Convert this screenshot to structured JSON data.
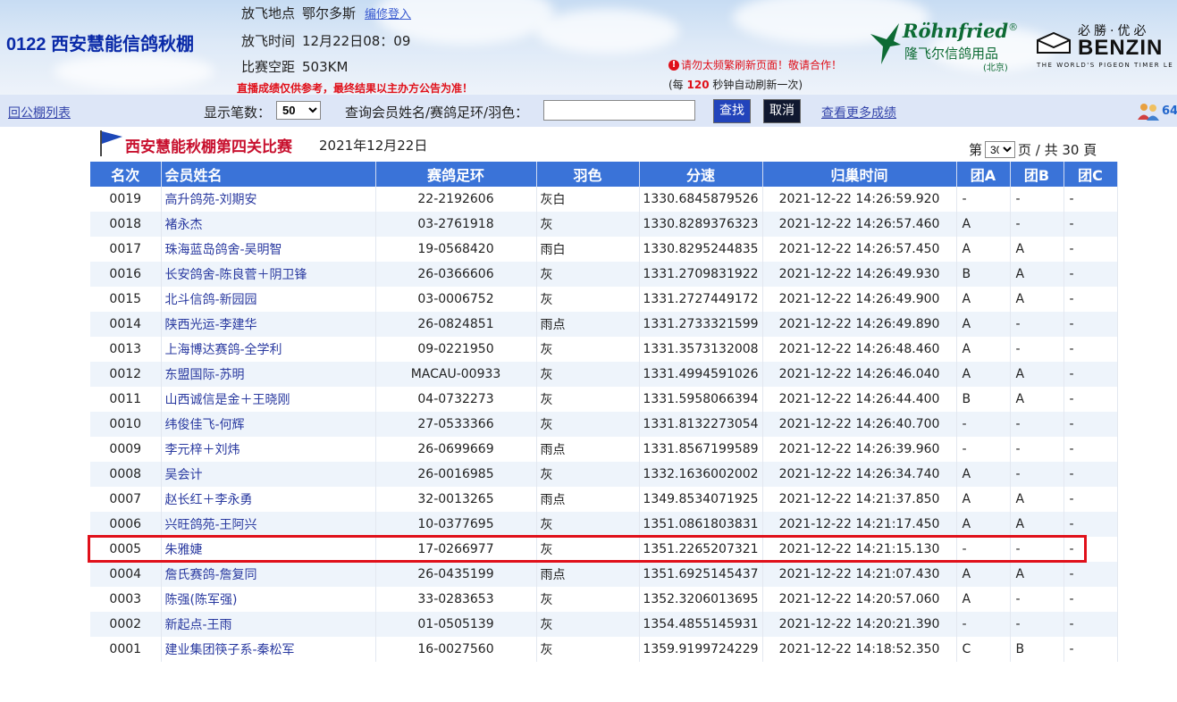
{
  "header": {
    "title": "0122 西安慧能信鸽秋棚",
    "release_location_label": "放飞地点",
    "release_location": "鄂尔多斯",
    "relogin_link": "编修登入",
    "release_time_label": "放飞时间",
    "release_time": "12月22日08：09",
    "distance_label": "比赛空距",
    "distance": "503KM",
    "disclaimer": "直播成绩仅供参考，最终结果以主办方公告为准！",
    "warning": "请勿太频繁刷新页面！敬请合作！",
    "refresh_prefix": "(每 ",
    "refresh_seconds": "120",
    "refresh_suffix": " 秒钟自动刷新一次)",
    "brand1_name": "Röhnfried",
    "brand1_mark": "®",
    "brand1_cn": "隆飞尔信鸽用品",
    "brand1_city": "(北京)",
    "brand2_top": "必勝·优必",
    "brand2_name": "BENZIN",
    "brand2_sub": "THE WORLD'S PIGEON TIMER LE"
  },
  "toolbar": {
    "back_link": "回公棚列表",
    "count_label": "显示笔数：",
    "count_value": "50",
    "query_label": "查询会员姓名/赛鸽足环/羽色：",
    "query_value": "",
    "search_button": "查找",
    "cancel_button": "取消",
    "more_link": "查看更多成绩",
    "online_count": "64"
  },
  "race": {
    "title": "西安慧能秋棚第四关比赛",
    "date": "2021年12月22日",
    "page_prefix": "第",
    "current_page": "30",
    "page_suffix": "页 / 共 30 頁"
  },
  "table": {
    "columns": [
      "名次",
      "会员姓名",
      "赛鸽足环",
      "羽色",
      "分速",
      "归巢时间",
      "团A",
      "团B",
      "团C"
    ],
    "rows": [
      [
        "0019",
        "高升鸽苑-刘期安",
        "22-2192606",
        "灰白",
        "1330.6845879526",
        "2021-12-22 14:26:59.920",
        "-",
        "-",
        "-"
      ],
      [
        "0018",
        "褚永杰",
        "03-2761918",
        "灰",
        "1330.8289376323",
        "2021-12-22 14:26:57.460",
        "A",
        "-",
        "-"
      ],
      [
        "0017",
        "珠海蓝岛鸽舍-吴明智",
        "19-0568420",
        "雨白",
        "1330.8295244835",
        "2021-12-22 14:26:57.450",
        "A",
        "A",
        "-"
      ],
      [
        "0016",
        "长安鸽舍-陈良菅＋阴卫锋",
        "26-0366606",
        "灰",
        "1331.2709831922",
        "2021-12-22 14:26:49.930",
        "B",
        "A",
        "-"
      ],
      [
        "0015",
        "北斗信鸽-新园园",
        "03-0006752",
        "灰",
        "1331.2727449172",
        "2021-12-22 14:26:49.900",
        "A",
        "A",
        "-"
      ],
      [
        "0014",
        "陕西光运-李建华",
        "26-0824851",
        "雨点",
        "1331.2733321599",
        "2021-12-22 14:26:49.890",
        "A",
        "-",
        "-"
      ],
      [
        "0013",
        "上海博达赛鸽-全学利",
        "09-0221950",
        "灰",
        "1331.3573132008",
        "2021-12-22 14:26:48.460",
        "A",
        "-",
        "-"
      ],
      [
        "0012",
        "东盟国际-苏明",
        "MACAU-00933",
        "灰",
        "1331.4994591026",
        "2021-12-22 14:26:46.040",
        "A",
        "A",
        "-"
      ],
      [
        "0011",
        "山西诚信是金＋王晓刚",
        "04-0732273",
        "灰",
        "1331.5958066394",
        "2021-12-22 14:26:44.400",
        "B",
        "A",
        "-"
      ],
      [
        "0010",
        "纬俊佳飞-何辉",
        "27-0533366",
        "灰",
        "1331.8132273054",
        "2021-12-22 14:26:40.700",
        "-",
        "-",
        "-"
      ],
      [
        "0009",
        "李元梓＋刘炜",
        "26-0699669",
        "雨点",
        "1331.8567199589",
        "2021-12-22 14:26:39.960",
        "-",
        "-",
        "-"
      ],
      [
        "0008",
        "吴会计",
        "26-0016985",
        "灰",
        "1332.1636002002",
        "2021-12-22 14:26:34.740",
        "A",
        "-",
        "-"
      ],
      [
        "0007",
        "赵长红＋李永勇",
        "32-0013265",
        "雨点",
        "1349.8534071925",
        "2021-12-22 14:21:37.850",
        "A",
        "A",
        "-"
      ],
      [
        "0006",
        "兴旺鸽苑-王阿兴",
        "10-0377695",
        "灰",
        "1351.0861803831",
        "2021-12-22 14:21:17.450",
        "A",
        "A",
        "-"
      ],
      [
        "0005",
        "朱雅婕",
        "17-0266977",
        "灰",
        "1351.2265207321",
        "2021-12-22 14:21:15.130",
        "-",
        "-",
        "-"
      ],
      [
        "0004",
        "詹氏赛鸽-詹复同",
        "26-0435199",
        "雨点",
        "1351.6925145437",
        "2021-12-22 14:21:07.430",
        "A",
        "A",
        "-"
      ],
      [
        "0003",
        "陈强(陈军强)",
        "33-0283653",
        "灰",
        "1352.3206013695",
        "2021-12-22 14:20:57.060",
        "A",
        "-",
        "-"
      ],
      [
        "0002",
        "新起点-王雨",
        "01-0505139",
        "灰",
        "1354.4855145931",
        "2021-12-22 14:20:21.390",
        "-",
        "-",
        "-"
      ],
      [
        "0001",
        "建业集团筷子系-秦松军",
        "16-0027560",
        "灰",
        "1359.9199724229",
        "2021-12-22 14:18:52.350",
        "C",
        "B",
        "-"
      ]
    ],
    "highlighted_row": 14
  },
  "colors": {
    "header_bg": "#3a73d8",
    "title_blue": "#0a2aa8",
    "alert_red": "#e0101a",
    "brand_green": "#0d6b34"
  }
}
